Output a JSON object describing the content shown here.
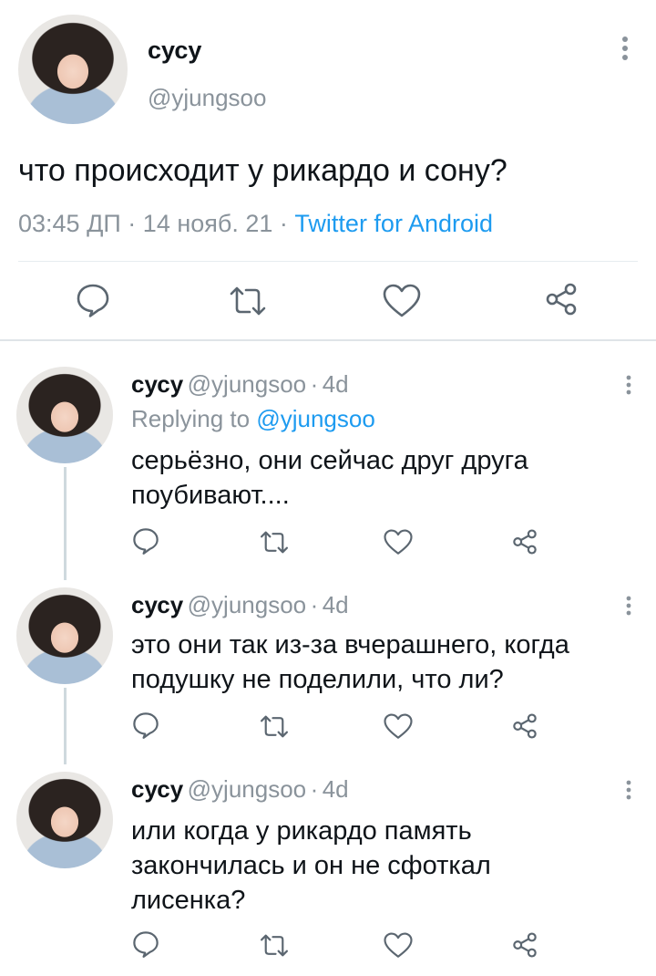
{
  "main_tweet": {
    "name": "сусу",
    "handle": "@yjungsoo",
    "text": "что происходит у рикардо и сону?",
    "time": "03:45 ДП",
    "date": "14 нояб. 21",
    "source": "Twitter for Android",
    "dot": "·"
  },
  "replies": [
    {
      "name": "сусу",
      "handle": "@yjungsoo",
      "age": "4d",
      "replying_prefix": "Replying to",
      "replying_to": "@yjungsoo",
      "text_lines": [
        "серьёзно, они сейчас друг друга",
        "поубивают...."
      ]
    },
    {
      "name": "сусу",
      "handle": "@yjungsoo",
      "age": "4d",
      "text_lines": [
        "это они так из-за вчерашнего, когда",
        "подушку не поделили, что ли?"
      ]
    },
    {
      "name": "сусу",
      "handle": "@yjungsoo",
      "age": "4d",
      "text_lines": [
        "или когда у рикардо память",
        "закончилась и он не сфоткал",
        "лисенка?"
      ]
    }
  ],
  "icons": [
    "reply-icon",
    "retweet-icon",
    "like-icon",
    "share-icon",
    "more-icon"
  ],
  "colors": {
    "link": "#1d9bf0",
    "muted": "#8a939b",
    "text": "#0f1419"
  }
}
